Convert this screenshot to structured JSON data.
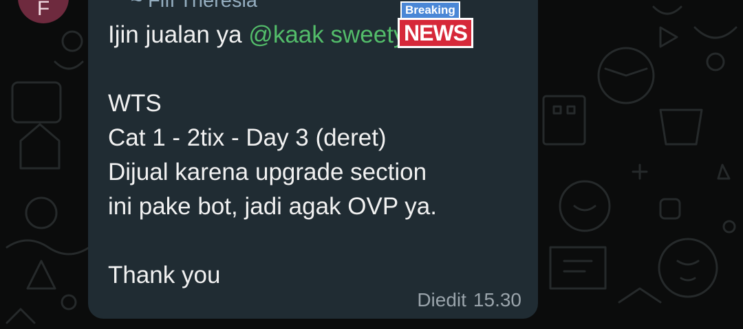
{
  "chat": {
    "avatar_initial": "F",
    "sender_name": "~ Fifi Theresia",
    "message_lines": [
      {
        "prefix": "Ijin jualan ya ",
        "mention": "@kaak sweetyy"
      },
      {
        "text": ""
      },
      {
        "text": "WTS"
      },
      {
        "text": "Cat 1 - 2tix - Day 3 (deret)"
      },
      {
        "text": "Dijual karena upgrade section"
      },
      {
        "text": "ini pake bot, jadi agak OVP ya."
      },
      {
        "text": ""
      },
      {
        "text": "Thank you"
      }
    ],
    "edited_label": "Diedit",
    "time": "15.30"
  },
  "sticker": {
    "top_text": "Breaking",
    "main_text": "NEWS"
  },
  "colors": {
    "background": "#0b0c0c",
    "bubble": "#202c33",
    "mention": "#53bd6a",
    "avatar": "#6e2a3e"
  }
}
